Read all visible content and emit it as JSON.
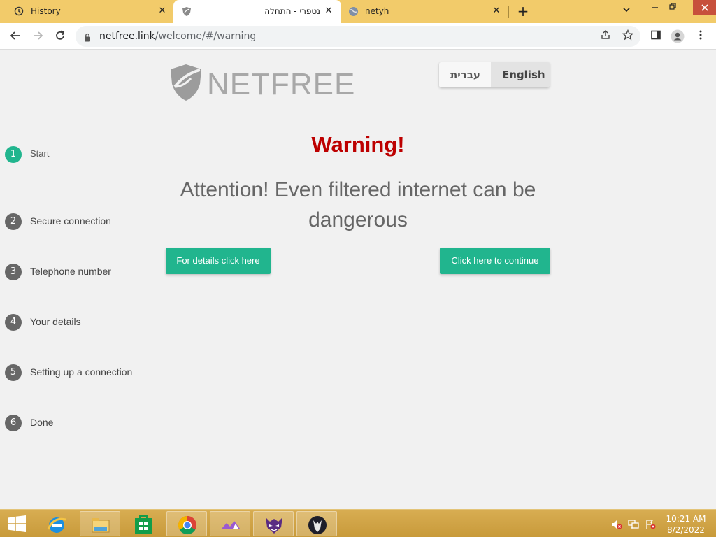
{
  "browser": {
    "tabs": [
      {
        "title": "History",
        "icon": "history-icon",
        "active": false
      },
      {
        "title": "נטפרי - התחלה",
        "icon": "netfree-shield-icon",
        "active": true
      },
      {
        "title": "netyh",
        "icon": "globe-icon",
        "active": false
      }
    ],
    "close_glyph": "✕",
    "new_tab_glyph": "+",
    "url_host": "netfree.link",
    "url_rest": "/welcome/#/warning"
  },
  "page": {
    "logo_text": "NETFREE",
    "lang": {
      "hebrew": "עברית",
      "english": "English",
      "selected": "English"
    },
    "warning_title": "Warning!",
    "attention_line1": "Attention! Even filtered internet can be",
    "attention_line2": "dangerous",
    "details_button": "For details click here",
    "continue_button": "Click here to continue",
    "steps": [
      {
        "num": "1",
        "label": "Start",
        "active": true
      },
      {
        "num": "2",
        "label": "Secure connection",
        "active": false
      },
      {
        "num": "3",
        "label": "Telephone number",
        "active": false
      },
      {
        "num": "4",
        "label": "Your details",
        "active": false
      },
      {
        "num": "5",
        "label": "Setting up a connection",
        "active": false
      },
      {
        "num": "6",
        "label": "Done",
        "active": false
      }
    ],
    "colors": {
      "accent": "#21b58e",
      "warning": "#bd0000",
      "step_inactive": "#676767"
    }
  },
  "taskbar": {
    "apps": [
      "internet-explorer-icon",
      "file-explorer-icon",
      "store-icon",
      "chrome-icon",
      "app-purple-icon",
      "app-mask-icon",
      "app-wolf-icon"
    ],
    "time": "10:21 AM",
    "date": "8/2/2022"
  }
}
